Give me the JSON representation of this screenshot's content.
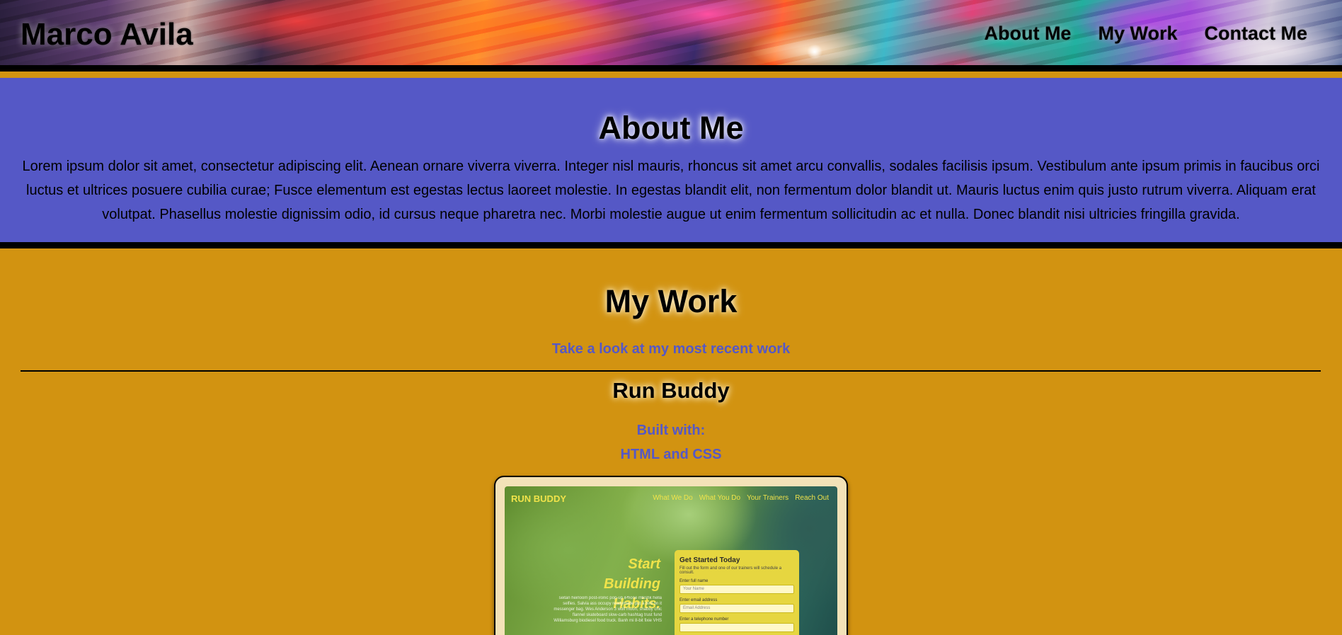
{
  "header": {
    "title": "Marco Avila",
    "nav": [
      "About Me",
      "My Work",
      "Contact Me"
    ]
  },
  "about": {
    "heading": "About Me",
    "body": "Lorem ipsum dolor sit amet, consectetur adipiscing elit. Aenean ornare viverra viverra. Integer nisl mauris, rhoncus sit amet arcu convallis, sodales facilisis ipsum. Vestibulum ante ipsum primis in faucibus orci luctus et ultrices posuere cubilia curae; Fusce elementum est egestas lectus laoreet molestie. In egestas blandit elit, non fermentum dolor blandit ut. Mauris luctus enim quis justo rutrum viverra. Aliquam erat volutpat. Phasellus molestie dignissim odio, id cursus neque pharetra nec. Morbi molestie augue ut enim fermentum sollicitudin ac et nulla. Donec blandit nisi ultricies fringilla gravida."
  },
  "work": {
    "heading": "My Work",
    "subtitle": "Take a look at my most recent work",
    "projects": [
      {
        "title": "Run Buddy",
        "built_label": "Built with:",
        "built_tech": "HTML and CSS",
        "screenshot": {
          "logo": "RUN BUDDY",
          "nav": [
            "What We Do",
            "What You Do",
            "Your Trainers",
            "Reach Out"
          ],
          "hero_line1": "Start Building",
          "hero_line2": "Habits.",
          "copy": "seitan heirloom post-ironic pop-up iPhone mlkshk hella selfies. Salvia ass occupy readymade put a bird on it messenger bag. Wes Anderson 3 wolf moon, shabby chic flannel skateboard slow-carb hashtag trust fund Williamsburg biodiesel food truck. Banh mi 8-bit fixie VHS",
          "form_title": "Get Started Today",
          "form_sub": "Fill out the form and one of our trainers will schedule a consult.",
          "fields": [
            {
              "label": "Enter full name",
              "placeholder": "Your Name"
            },
            {
              "label": "Enter email address",
              "placeholder": "Email Address"
            },
            {
              "label": "Enter a telephone number",
              "placeholder": ""
            }
          ]
        }
      }
    ]
  },
  "colors": {
    "about_bg": "#5558c6",
    "work_bg": "#d29311",
    "accent_text": "#5558c6",
    "divider": "#000000"
  }
}
